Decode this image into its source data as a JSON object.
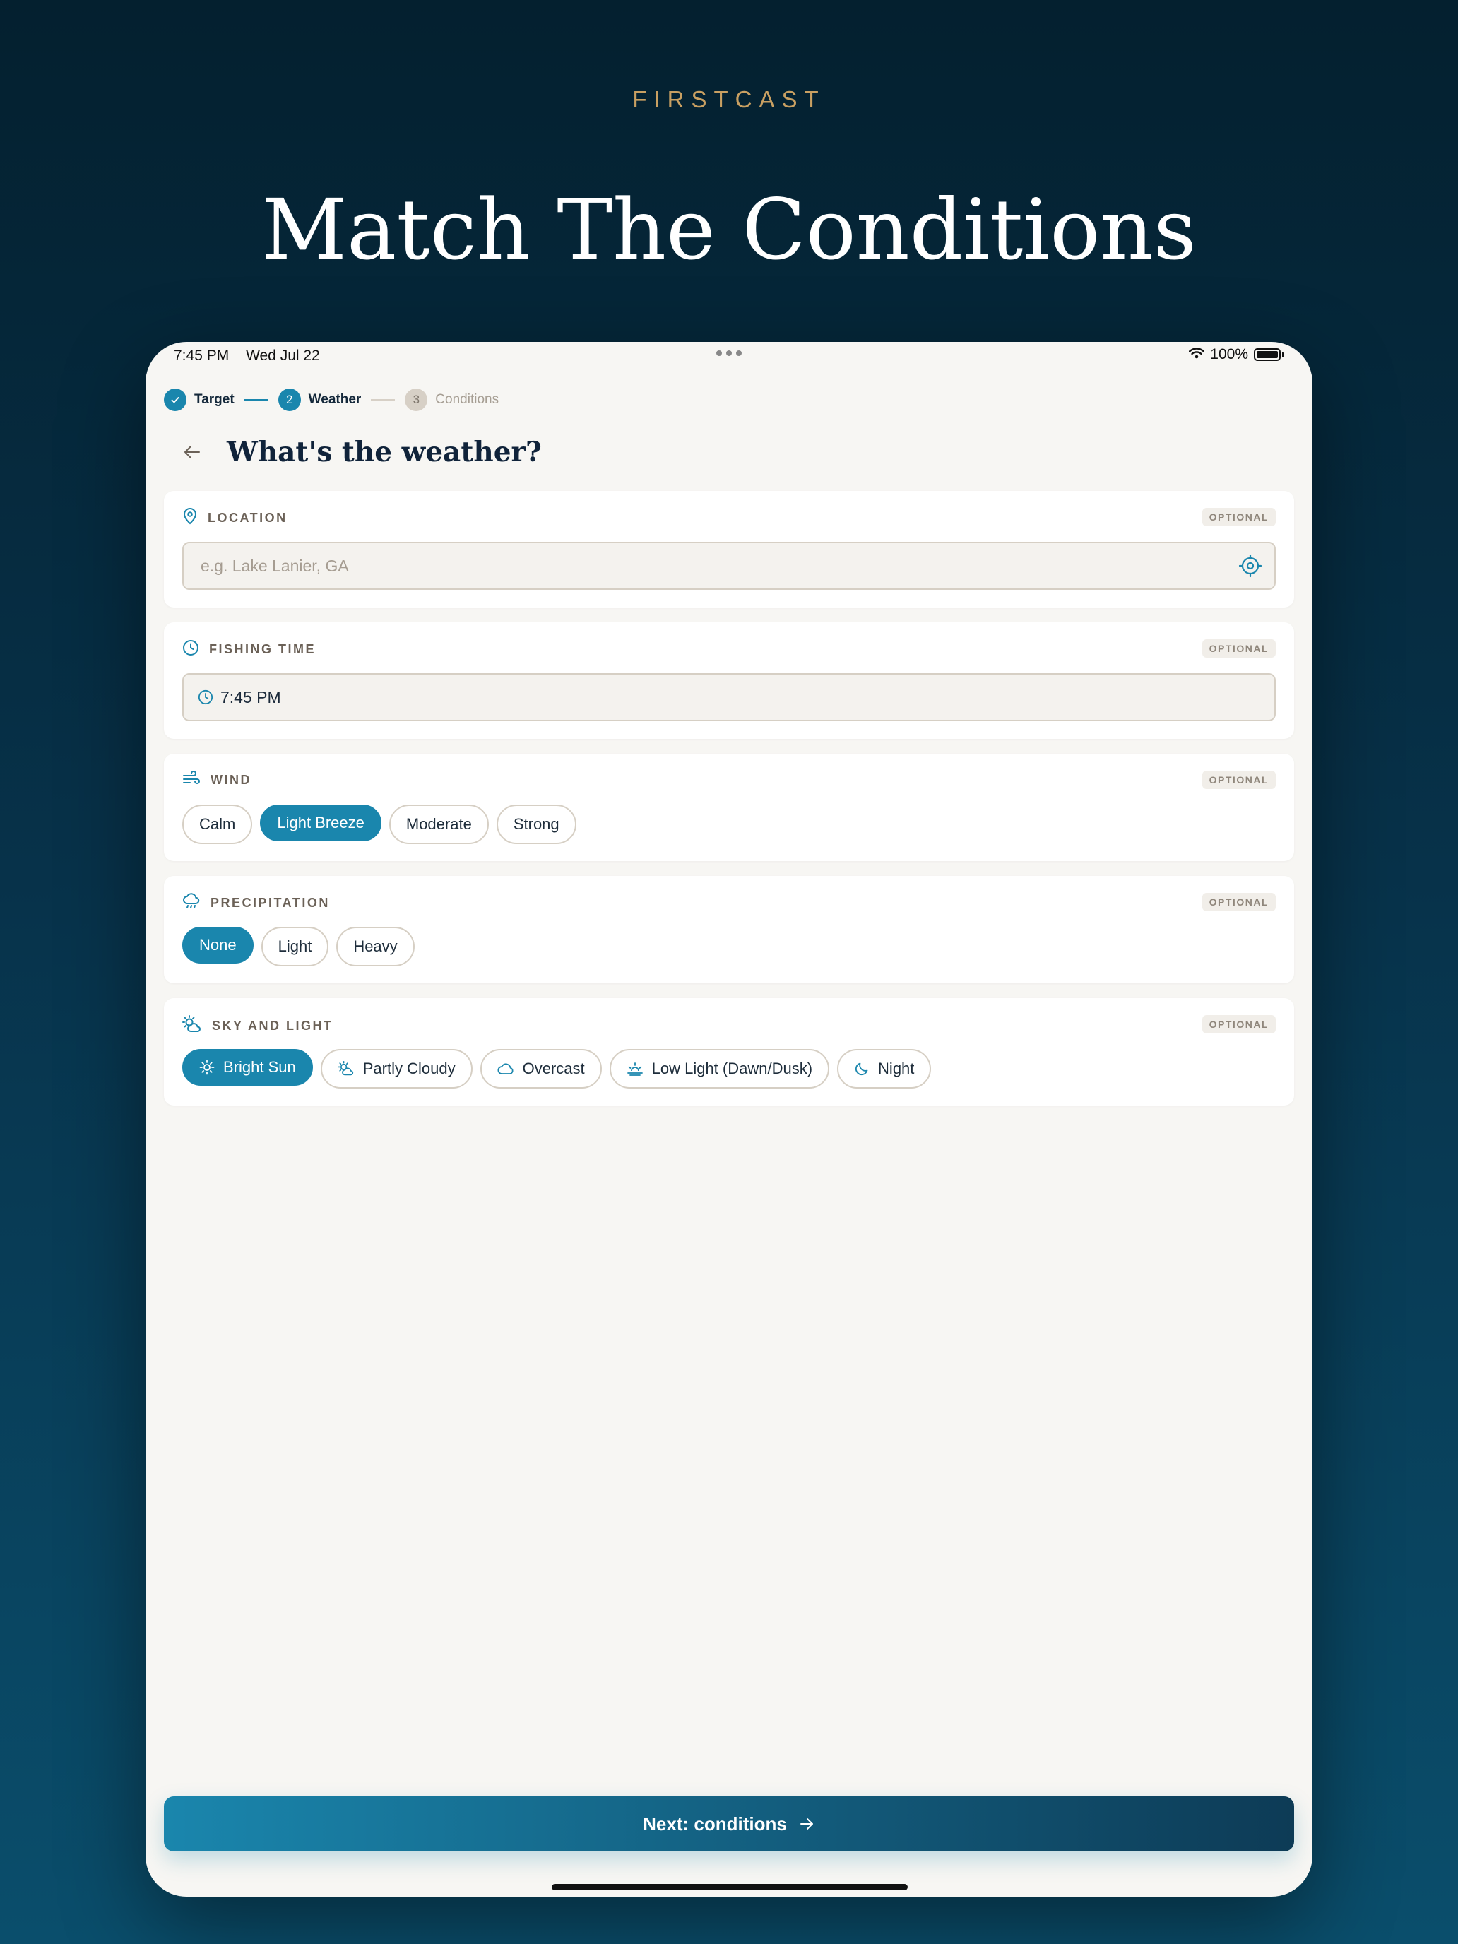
{
  "brand": "FIRSTCAST",
  "headline": "Match The Conditions",
  "status_bar": {
    "time": "7:45 PM",
    "date": "Wed Jul 22",
    "battery": "100%"
  },
  "stepper": {
    "steps": [
      {
        "number": "1",
        "label": "Target",
        "state": "done"
      },
      {
        "number": "2",
        "label": "Weather",
        "state": "current"
      },
      {
        "number": "3",
        "label": "Conditions",
        "state": "upcoming"
      }
    ]
  },
  "page_title": "What's the weather?",
  "optional_label": "OPTIONAL",
  "location": {
    "label": "LOCATION",
    "placeholder": "e.g. Lake Lanier, GA",
    "value": ""
  },
  "fishing_time": {
    "label": "FISHING TIME",
    "value": "7:45 PM"
  },
  "wind": {
    "label": "WIND",
    "options": [
      "Calm",
      "Light Breeze",
      "Moderate",
      "Strong"
    ],
    "selected": "Light Breeze"
  },
  "precipitation": {
    "label": "PRECIPITATION",
    "options": [
      "None",
      "Light",
      "Heavy"
    ],
    "selected": "None"
  },
  "sky": {
    "label": "SKY AND LIGHT",
    "options": [
      {
        "label": "Bright Sun",
        "icon": "sun-icon"
      },
      {
        "label": "Partly Cloudy",
        "icon": "partly-cloudy-icon"
      },
      {
        "label": "Overcast",
        "icon": "cloud-icon"
      },
      {
        "label": "Low Light (Dawn/Dusk)",
        "icon": "sunrise-icon"
      },
      {
        "label": "Night",
        "icon": "moon-icon"
      }
    ],
    "selected": "Bright Sun"
  },
  "next_button": {
    "label": "Next: conditions"
  },
  "colors": {
    "accent": "#1a86ad",
    "brand_gold": "#c9a062",
    "navy": "#10233a",
    "surface": "#f7f6f3"
  }
}
